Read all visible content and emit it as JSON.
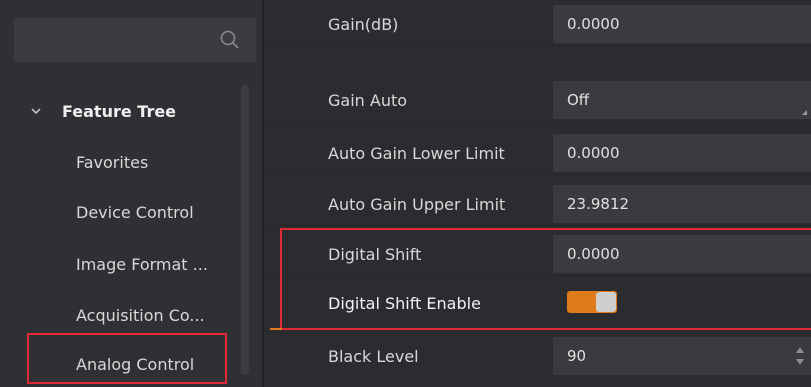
{
  "search": {
    "placeholder": ""
  },
  "sidebar": {
    "tree_title": "Feature Tree",
    "items": [
      {
        "label": "Favorites"
      },
      {
        "label": "Device Control"
      },
      {
        "label": "Image Format ..."
      },
      {
        "label": "Acquisition Co..."
      },
      {
        "label": "Analog Control",
        "selected": true
      }
    ]
  },
  "properties": [
    {
      "label": "Gain(dB)",
      "value": "0.0000",
      "type": "text"
    },
    {
      "label": "Gain Auto",
      "value": "Off",
      "type": "dropdown"
    },
    {
      "label": "Auto Gain Lower Limit",
      "value": "0.0000",
      "type": "text"
    },
    {
      "label": "Auto Gain Upper Limit",
      "value": "23.9812",
      "type": "text"
    },
    {
      "label": "Digital Shift",
      "value": "0.0000",
      "type": "text"
    },
    {
      "label": "Digital Shift Enable",
      "value": "on",
      "type": "toggle"
    },
    {
      "label": "Black Level",
      "value": "90",
      "type": "spinner"
    }
  ],
  "colors": {
    "accent": "#e07b1a",
    "highlight": "#e02a35",
    "panel_bg": "#2b2c30",
    "sidebar_bg": "#2f3034"
  },
  "icons": {
    "search": "search-icon",
    "tree_expand": "chevron-down-icon"
  }
}
